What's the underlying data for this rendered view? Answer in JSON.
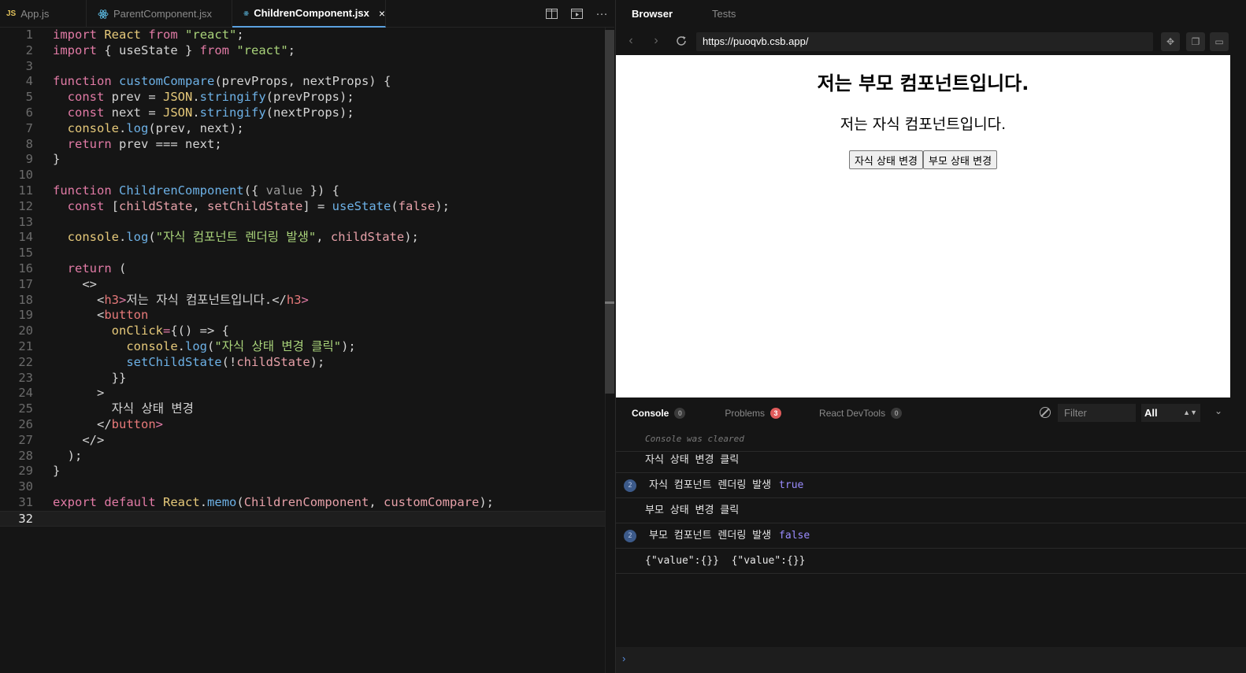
{
  "editor": {
    "tabs": [
      {
        "icon": "js-file-icon",
        "badge": "JS",
        "label": "App.js",
        "active": false
      },
      {
        "icon": "react-file-icon",
        "label": "ParentComponent.jsx",
        "active": false
      },
      {
        "icon": "react-file-icon",
        "label": "ChildrenComponent.jsx",
        "active": true,
        "close": "×"
      }
    ],
    "toolbar": {
      "split_icon": "split-editor-icon",
      "preview_icon": "open-preview-icon",
      "more_label": "···"
    },
    "current_line": 32,
    "code_lines": [
      "import React from \"react\";",
      "import { useState } from \"react\";",
      "",
      "function customCompare(prevProps, nextProps) {",
      "  const prev = JSON.stringify(prevProps);",
      "  const next = JSON.stringify(nextProps);",
      "  console.log(prev, next);",
      "  return prev === next;",
      "}",
      "",
      "function ChildrenComponent({ value }) {",
      "  const [childState, setChildState] = useState(false);",
      "",
      "  console.log(\"자식 컴포넌트 렌더링 발생\", childState);",
      "",
      "  return (",
      "    <>",
      "      <h3>저는 자식 컴포넌트입니다.</h3>",
      "      <button",
      "        onClick={() => {",
      "          console.log(\"자식 상태 변경 클릭\");",
      "          setChildState(!childState);",
      "        }}",
      "      >",
      "        자식 상태 변경",
      "      </button>",
      "    </>",
      "  );",
      "}",
      "",
      "export default React.memo(ChildrenComponent, customCompare);",
      ""
    ]
  },
  "panel": {
    "tabs": {
      "browser": "Browser",
      "tests": "Tests"
    },
    "nav": {
      "back_icon": "back-arrow-icon",
      "forward_icon": "forward-arrow-icon",
      "reload_icon": "reload-icon",
      "url": "https://puoqvb.csb.app/"
    },
    "preview": {
      "parent_heading": "저는 부모 컴포넌트입니다.",
      "child_heading": "저는 자식 컴포넌트입니다.",
      "child_button": "자식 상태 변경",
      "parent_button": "부모 상태 변경"
    },
    "console_tabs": {
      "console": "Console",
      "console_count": "0",
      "problems": "Problems",
      "problems_count": "3",
      "devtools": "React DevTools",
      "devtools_count": "0"
    },
    "filter_placeholder": "Filter",
    "level": "All",
    "console_lines": {
      "cleared": "Console was cleared",
      "l1": "자식 상태 변경 클릭",
      "l2_count": "2",
      "l2": "자식 컴포넌트 렌더링 발생",
      "l2_val": "true",
      "l3": "부모 상태 변경 클릭",
      "l4_count": "2",
      "l4": "부모 컴포넌트 렌더링 발생",
      "l4_val": "false",
      "l5": "{\"value\":{}}  {\"value\":{}}"
    },
    "prompt": "›"
  },
  "colors": {
    "accent": "#5ba1e0",
    "problems_badge": "#e05b5b",
    "keyword": "#e27ba6",
    "string": "#a9d37a",
    "function": "#6db1e6"
  }
}
